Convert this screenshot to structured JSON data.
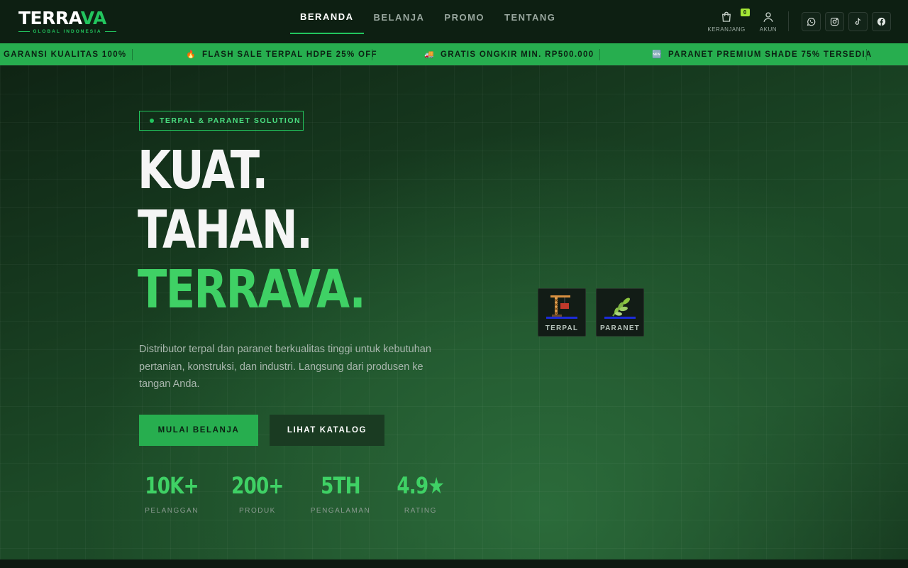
{
  "brand": {
    "name_main": "TERRA",
    "name_accent": "VA",
    "tagline": "GLOBAL INDONESIA"
  },
  "nav": [
    {
      "label": "BERANDA",
      "active": true
    },
    {
      "label": "BELANJA",
      "active": false
    },
    {
      "label": "PROMO",
      "active": false
    },
    {
      "label": "TENTANG",
      "active": false
    }
  ],
  "header_actions": {
    "cart_label": "KERANJANG",
    "cart_count": "0",
    "account_label": "AKUN"
  },
  "social": [
    "whatsapp-icon",
    "instagram-icon",
    "tiktok-icon",
    "facebook-icon"
  ],
  "ticker": [
    {
      "icon": "",
      "text": "GARANSI KUALITAS 100%"
    },
    {
      "icon": "🔥",
      "text": "FLASH SALE TERPAL HDPE 25% OFF"
    },
    {
      "icon": "🚚",
      "text": "GRATIS ONGKIR MIN. RP500.000"
    },
    {
      "icon": "🆕",
      "text": "PARANET PREMIUM SHADE 75% TERSEDIA"
    }
  ],
  "hero": {
    "pill": "TERPAL & PARANET SOLUTION",
    "headline": [
      "KUAT.",
      "TAHAN.",
      "TERRAVA."
    ],
    "description": "Distributor terpal dan paranet berkualitas tinggi untuk kebutuhan pertanian, konstruksi, dan industri. Langsung dari produsen ke tangan Anda.",
    "cta_primary": "MULAI BELANJA",
    "cta_secondary": "LIHAT KATALOG",
    "stats": [
      {
        "value": "10K+",
        "label": "PELANGGAN"
      },
      {
        "value": "200+",
        "label": "PRODUK"
      },
      {
        "value": "5TH",
        "label": "PENGALAMAN"
      },
      {
        "value": "4.9★",
        "label": "RATING"
      }
    ]
  },
  "categories": [
    {
      "label": "TERPAL",
      "icon": "crane-icon"
    },
    {
      "label": "PARANET",
      "icon": "leaf-icon"
    }
  ],
  "colors": {
    "accent": "#22c55e",
    "ticker_bg": "#27ae4f",
    "header_bg": "#0d1f12"
  }
}
